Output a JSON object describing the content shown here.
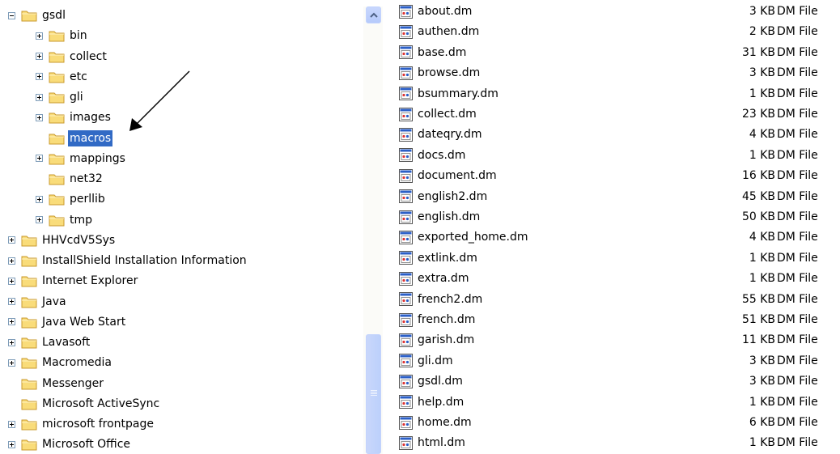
{
  "tree": [
    {
      "label": "gsdl",
      "level": 0,
      "expander": "minus",
      "selected": false
    },
    {
      "label": "bin",
      "level": 1,
      "expander": "plus",
      "selected": false
    },
    {
      "label": "collect",
      "level": 1,
      "expander": "plus",
      "selected": false
    },
    {
      "label": "etc",
      "level": 1,
      "expander": "plus",
      "selected": false
    },
    {
      "label": "gli",
      "level": 1,
      "expander": "plus",
      "selected": false
    },
    {
      "label": "images",
      "level": 1,
      "expander": "plus",
      "selected": false
    },
    {
      "label": "macros",
      "level": 1,
      "expander": "none",
      "selected": true
    },
    {
      "label": "mappings",
      "level": 1,
      "expander": "plus",
      "selected": false
    },
    {
      "label": "net32",
      "level": 1,
      "expander": "none",
      "selected": false
    },
    {
      "label": "perllib",
      "level": 1,
      "expander": "plus",
      "selected": false
    },
    {
      "label": "tmp",
      "level": 1,
      "expander": "plus",
      "selected": false
    },
    {
      "label": "HHVcdV5Sys",
      "level": 0,
      "expander": "plus",
      "selected": false
    },
    {
      "label": "InstallShield Installation Information",
      "level": 0,
      "expander": "plus",
      "selected": false
    },
    {
      "label": "Internet Explorer",
      "level": 0,
      "expander": "plus",
      "selected": false
    },
    {
      "label": "Java",
      "level": 0,
      "expander": "plus",
      "selected": false
    },
    {
      "label": "Java Web Start",
      "level": 0,
      "expander": "plus",
      "selected": false
    },
    {
      "label": "Lavasoft",
      "level": 0,
      "expander": "plus",
      "selected": false
    },
    {
      "label": "Macromedia",
      "level": 0,
      "expander": "plus",
      "selected": false
    },
    {
      "label": "Messenger",
      "level": 0,
      "expander": "none",
      "selected": false
    },
    {
      "label": "Microsoft ActiveSync",
      "level": 0,
      "expander": "none",
      "selected": false
    },
    {
      "label": "microsoft frontpage",
      "level": 0,
      "expander": "plus",
      "selected": false
    },
    {
      "label": "Microsoft Office",
      "level": 0,
      "expander": "plus",
      "selected": false
    }
  ],
  "files": [
    {
      "name": "about.dm",
      "size": "3 KB",
      "type": "DM File"
    },
    {
      "name": "authen.dm",
      "size": "2 KB",
      "type": "DM File"
    },
    {
      "name": "base.dm",
      "size": "31 KB",
      "type": "DM File"
    },
    {
      "name": "browse.dm",
      "size": "3 KB",
      "type": "DM File"
    },
    {
      "name": "bsummary.dm",
      "size": "1 KB",
      "type": "DM File"
    },
    {
      "name": "collect.dm",
      "size": "23 KB",
      "type": "DM File"
    },
    {
      "name": "dateqry.dm",
      "size": "4 KB",
      "type": "DM File"
    },
    {
      "name": "docs.dm",
      "size": "1 KB",
      "type": "DM File"
    },
    {
      "name": "document.dm",
      "size": "16 KB",
      "type": "DM File"
    },
    {
      "name": "english2.dm",
      "size": "45 KB",
      "type": "DM File"
    },
    {
      "name": "english.dm",
      "size": "50 KB",
      "type": "DM File"
    },
    {
      "name": "exported_home.dm",
      "size": "4 KB",
      "type": "DM File"
    },
    {
      "name": "extlink.dm",
      "size": "1 KB",
      "type": "DM File"
    },
    {
      "name": "extra.dm",
      "size": "1 KB",
      "type": "DM File"
    },
    {
      "name": "french2.dm",
      "size": "55 KB",
      "type": "DM File"
    },
    {
      "name": "french.dm",
      "size": "51 KB",
      "type": "DM File"
    },
    {
      "name": "garish.dm",
      "size": "11 KB",
      "type": "DM File"
    },
    {
      "name": "gli.dm",
      "size": "3 KB",
      "type": "DM File"
    },
    {
      "name": "gsdl.dm",
      "size": "3 KB",
      "type": "DM File"
    },
    {
      "name": "help.dm",
      "size": "1 KB",
      "type": "DM File"
    },
    {
      "name": "home.dm",
      "size": "6 KB",
      "type": "DM File"
    },
    {
      "name": "html.dm",
      "size": "1 KB",
      "type": "DM File"
    }
  ],
  "icons": {
    "folder": "folder-icon",
    "file": "dm-file-icon",
    "expand": "expand-plus-icon",
    "collapse": "collapse-minus-icon",
    "scroll_up": "scroll-up-arrow-icon"
  },
  "colors": {
    "selection": "#316ac5",
    "folder_fill": "#f9dc7a",
    "folder_stroke": "#c99a2e",
    "scroll_thumb": "#c1d3fb"
  },
  "scroll_position": 0.72
}
